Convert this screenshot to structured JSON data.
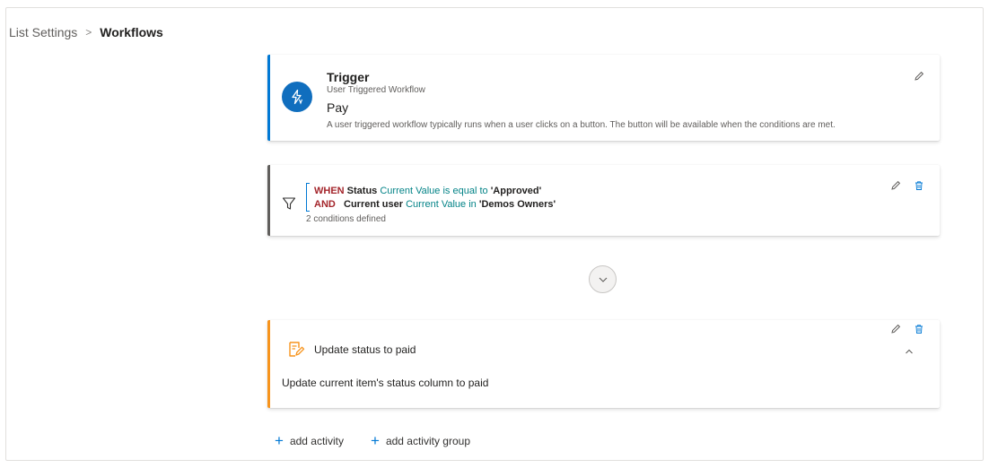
{
  "breadcrumb": {
    "root": "List Settings",
    "separator": ">",
    "current": "Workflows"
  },
  "trigger": {
    "title": "Trigger",
    "subtitle": "User Triggered Workflow",
    "name": "Pay",
    "description": "A user triggered workflow typically runs when a user clicks on a button. The button will be available when the conditions are met.",
    "icon": "lightning-icon"
  },
  "condition": {
    "lines": [
      {
        "keyword": "WHEN",
        "field": "Status",
        "operator": "Current Value is equal to",
        "value": "'Approved'"
      },
      {
        "keyword": "AND",
        "field": "Current user",
        "operator": "Current Value in",
        "value": "'Demos Owners'"
      }
    ],
    "count_text": "2 conditions defined",
    "icon": "filter-icon"
  },
  "activity": {
    "title": "Update status to paid",
    "description": "Update current item's status column to paid",
    "icon": "edit-document-icon"
  },
  "actions": {
    "add_activity": "add activity",
    "add_activity_group": "add activity group"
  },
  "colors": {
    "accent": "#0078d4",
    "trigger_bar": "#0078d4",
    "condition_bar": "#605e5c",
    "activity_bar": "#f7941d",
    "keyword": "#a4262c",
    "operator": "#038387"
  }
}
